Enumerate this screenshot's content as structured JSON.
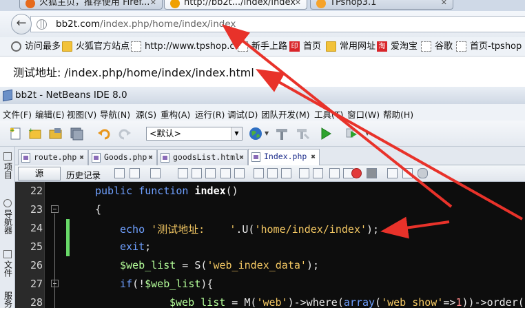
{
  "browser": {
    "tabs": [
      {
        "label": "火狐主页，推荐使用 Firef...",
        "active": false,
        "favicon_color": "#e66a1c"
      },
      {
        "label": "http://bb2t.../index/index",
        "active": true,
        "favicon_color": "#f0a000"
      },
      {
        "label": "TPshop3.1",
        "active": false,
        "favicon_color": "#f6a32a"
      }
    ],
    "url": {
      "host": "bb2t.com",
      "path": "/index.php/home/index/index"
    },
    "bookmarks": [
      {
        "label": "访问最多",
        "icon": "gear-icon"
      },
      {
        "label": "火狐官方站点",
        "icon": "folder-icon"
      },
      {
        "label": "http://www.tpshop.c...",
        "icon": "page-icon"
      },
      {
        "label": "新手上路",
        "icon": "page-icon"
      },
      {
        "label": "首页",
        "icon": "red-logo-icon"
      },
      {
        "label": "常用网址",
        "icon": "folder-icon"
      },
      {
        "label": "爱淘宝",
        "icon": "red-logo-icon"
      },
      {
        "label": "谷歌",
        "icon": "page-icon"
      },
      {
        "label": "首页-tpshop",
        "icon": "page-icon"
      }
    ],
    "page_text": "测试地址: /index.php/home/index/index.html"
  },
  "ide": {
    "title": "bb2t - NetBeans IDE 8.0",
    "menu": [
      "文件(F)",
      "编辑(E)",
      "视图(V)",
      "导航(N)",
      "源(S)",
      "重构(A)",
      "运行(R)",
      "调试(D)",
      "团队开发(M)",
      "工具(T)",
      "窗口(W)",
      "帮助(H)"
    ],
    "config_select": "<默认>",
    "side_tabs": [
      "项目",
      "导航器",
      "文件",
      "服务"
    ],
    "file_tabs": [
      {
        "label": "route.php",
        "active": false
      },
      {
        "label": "Goods.php",
        "active": false
      },
      {
        "label": "goodsList.html",
        "active": false
      },
      {
        "label": "Index.php",
        "active": true
      }
    ],
    "editor_bar": {
      "source": "源",
      "history": "历史记录"
    },
    "line_numbers": [
      "22",
      "23",
      "24",
      "25",
      "26",
      "27",
      "28"
    ],
    "code": {
      "l22": {
        "kw": "public function",
        "name": "index",
        "rest": "()"
      },
      "l23": {
        "text": "{"
      },
      "l24": {
        "kw": "echo",
        "str1": "'测试地址:    '",
        "mid": ".U(",
        "str2": "'home/index/index'",
        "end": ");"
      },
      "l25": {
        "kw": "exit",
        "end": ";"
      },
      "l26": {
        "var": "$web_list",
        "mid": " = S(",
        "str": "'web_index_data'",
        "end": ");"
      },
      "l27": {
        "kw": "if",
        "open": "(!",
        "var": "$web_list",
        "end": "){"
      },
      "l28": {
        "var": "$web_list",
        "mid": " = M(",
        "str1": "'web'",
        "mid2": ")->where(",
        "kw": "array",
        "open": "(",
        "str2": "'web_show'",
        "arrow": "=>",
        "num": "1",
        "end": "))->order("
      }
    }
  }
}
